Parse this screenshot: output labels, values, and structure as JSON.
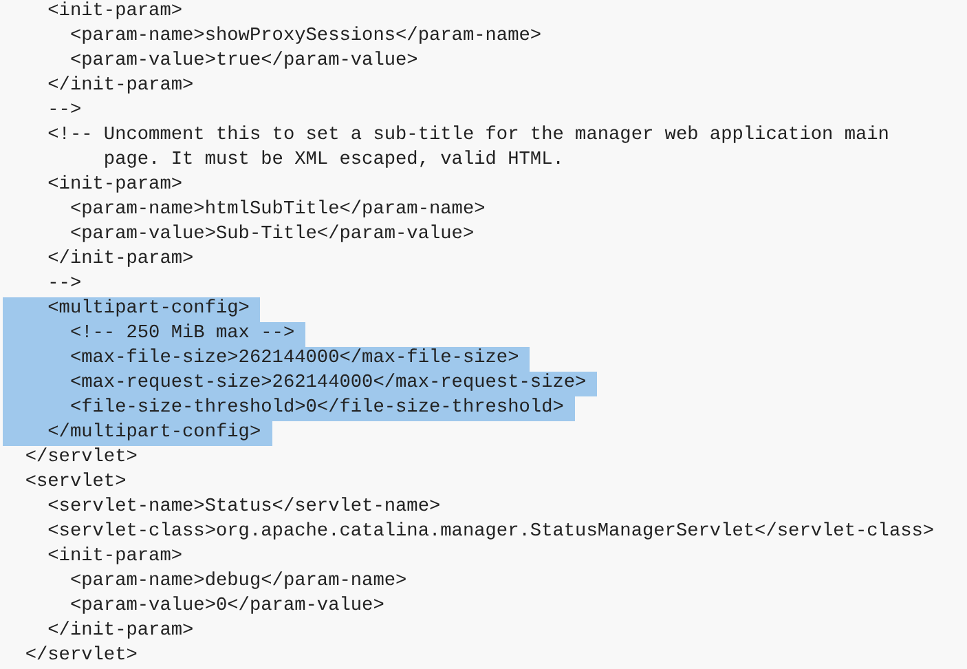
{
  "code_lines": [
    {
      "text": "    <init-param>",
      "selected": false
    },
    {
      "text": "      <param-name>showProxySessions</param-name>",
      "selected": false
    },
    {
      "text": "      <param-value>true</param-value>",
      "selected": false
    },
    {
      "text": "    </init-param>",
      "selected": false
    },
    {
      "text": "    -->",
      "selected": false
    },
    {
      "text": "    <!-- Uncomment this to set a sub-title for the manager web application main",
      "selected": false
    },
    {
      "text": "         page. It must be XML escaped, valid HTML.",
      "selected": false
    },
    {
      "text": "    <init-param>",
      "selected": false
    },
    {
      "text": "      <param-name>htmlSubTitle</param-name>",
      "selected": false
    },
    {
      "text": "      <param-value>Sub-Title</param-value>",
      "selected": false
    },
    {
      "text": "    </init-param>",
      "selected": false
    },
    {
      "text": "    -->",
      "selected": false
    },
    {
      "text": "    <multipart-config>",
      "selected": true
    },
    {
      "text": "      <!-- 250 MiB max -->",
      "selected": true
    },
    {
      "text": "      <max-file-size>262144000</max-file-size>",
      "selected": true
    },
    {
      "text": "      <max-request-size>262144000</max-request-size>",
      "selected": true
    },
    {
      "text": "      <file-size-threshold>0</file-size-threshold>",
      "selected": true
    },
    {
      "text": "    </multipart-config>",
      "selected": true
    },
    {
      "text": "  </servlet>",
      "selected": false
    },
    {
      "text": "  <servlet>",
      "selected": false
    },
    {
      "text": "    <servlet-name>Status</servlet-name>",
      "selected": false
    },
    {
      "text": "    <servlet-class>org.apache.catalina.manager.StatusManagerServlet</servlet-class>",
      "selected": false
    },
    {
      "text": "    <init-param>",
      "selected": false
    },
    {
      "text": "      <param-name>debug</param-name>",
      "selected": false
    },
    {
      "text": "      <param-value>0</param-value>",
      "selected": false
    },
    {
      "text": "    </init-param>",
      "selected": false
    },
    {
      "text": "  </servlet>",
      "selected": false
    }
  ]
}
